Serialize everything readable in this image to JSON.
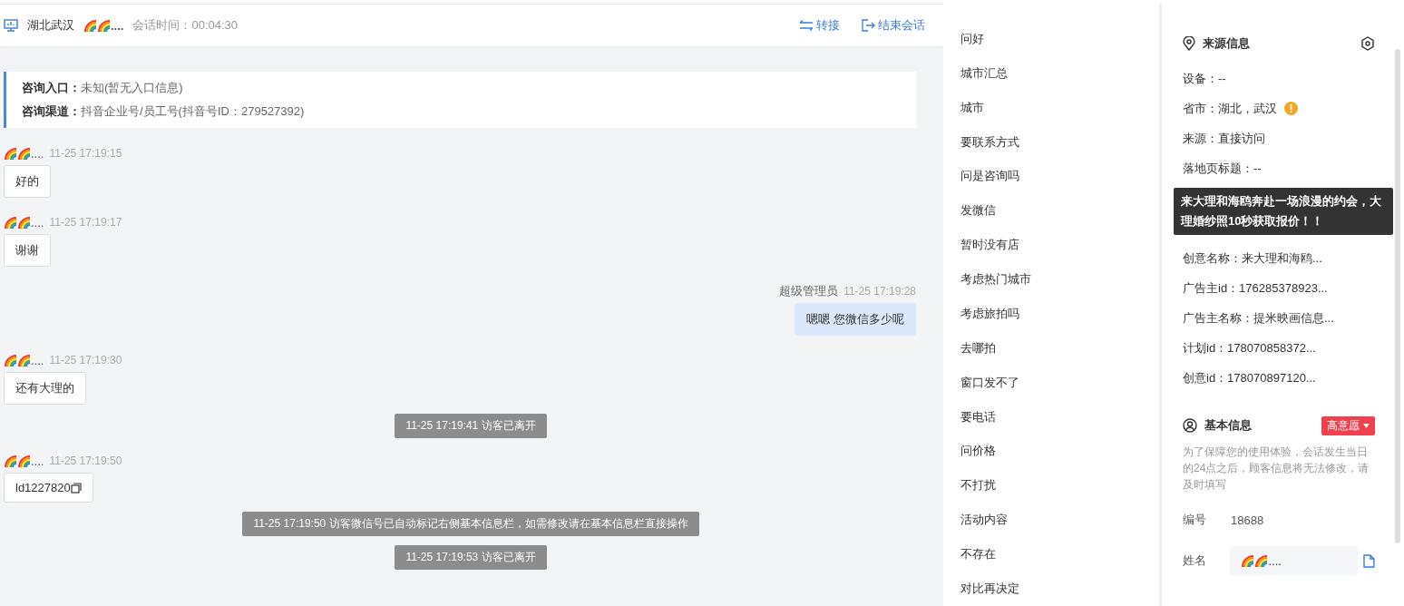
{
  "header": {
    "location": "湖北武汉",
    "visitor_name": "....",
    "duration_label": "会话时间：",
    "duration": "00:04:30",
    "actions": [
      {
        "kind": "transfer",
        "label": "转接"
      },
      {
        "kind": "end",
        "label": "结束会话"
      }
    ]
  },
  "consult_info": [
    {
      "label": "咨询入口：",
      "value": "未知(暂无入口信息)"
    },
    {
      "label": "咨询渠道：",
      "value": "抖音企业号/员工号(抖音号ID：279527392)"
    }
  ],
  "messages": [
    {
      "kind": "visitor",
      "name": "....",
      "time": "11-25 17:19:15",
      "text": "好的"
    },
    {
      "kind": "visitor",
      "name": "....",
      "time": "11-25 17:19:17",
      "text": "谢谢"
    },
    {
      "kind": "agent",
      "name": "超级管理员",
      "time": "11-25 17:19:28",
      "text": "嗯嗯 您微信多少呢"
    },
    {
      "kind": "visitor",
      "name": "....",
      "time": "11-25 17:19:30",
      "text": "还有大理的"
    },
    {
      "kind": "system",
      "text": "11-25 17:19:41 访客已离开"
    },
    {
      "kind": "visitor",
      "name": "....",
      "time": "11-25 17:19:50",
      "text": "ld1227820",
      "copy": true
    },
    {
      "kind": "system",
      "text": "11-25 17:19:50 访客微信号已自动标记右侧基本信息栏，如需修改请在基本信息栏直接操作"
    },
    {
      "kind": "system",
      "text": "11-25 17:19:53 访客已离开"
    }
  ],
  "quick_replies": [
    "问好",
    "城市汇总",
    "城市",
    "要联系方式",
    "问是咨询吗",
    "发微信",
    "暂时没有店",
    "考虑热门城市",
    "考虑旅拍吗",
    "去哪拍",
    "窗口发不了",
    "要电话",
    "问价格",
    "不打扰",
    "活动内容",
    "不存在",
    "对比再决定"
  ],
  "source_info": {
    "title": "来源信息",
    "rows_before": [
      {
        "text": "设备：--"
      },
      {
        "text": "省市：湖北，武汉",
        "warning": true
      },
      {
        "text": "来源：直接访问"
      },
      {
        "text": "落地页标题：--"
      }
    ],
    "rows_after": [
      {
        "text": "创意名称：来大理和海鸥..."
      },
      {
        "text": "广告主id：176285378923..."
      },
      {
        "text": "广告主名称：提米映画信息..."
      },
      {
        "text": "计划id：178070858372..."
      },
      {
        "text": "创意id：178070897120..."
      }
    ],
    "tooltip": "来大理和海鸥奔赴一场浪漫的约会，大理婚纱照10秒获取报价！！"
  },
  "basic_info": {
    "title": "基本信息",
    "intent_tag": "高意愿",
    "notice": "为了保障您的使用体验，会话发生当日的24点之后，顾客信息将无法修改，请及时填写",
    "fields": [
      {
        "kind": "text",
        "label": "编号",
        "value": "18688"
      },
      {
        "kind": "input",
        "label": "姓名",
        "value": "...."
      }
    ]
  }
}
